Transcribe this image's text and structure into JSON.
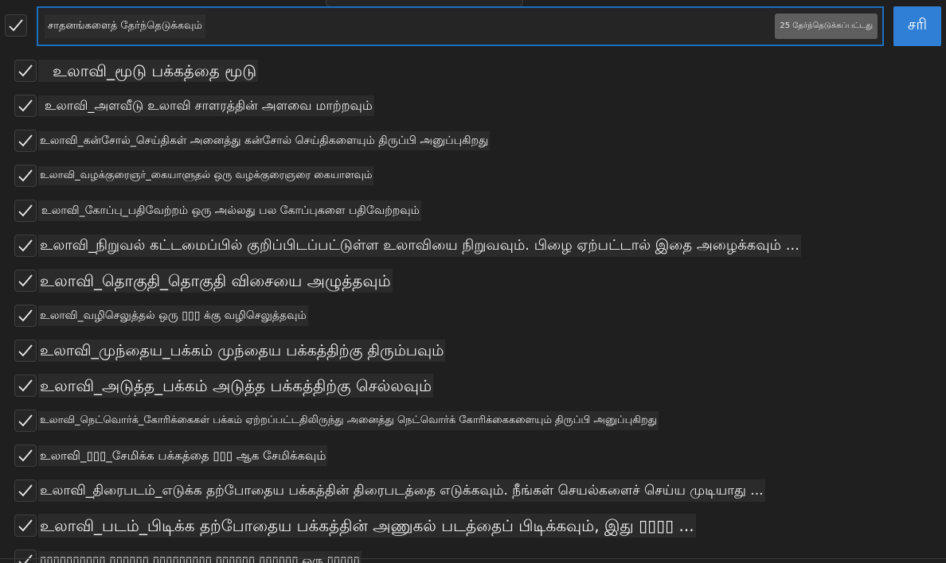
{
  "search": {
    "value": "சாதனங்களைத் தேர்ந்தெடுக்கவும்",
    "count_badge": "25 தேர்ந்தெடுக்கப்பட்டது",
    "ok_label": "சரி"
  },
  "tools": [
    {
      "name": "உலாவி_மூடு",
      "desc": "பக்கத்தை மூடு"
    },
    {
      "name": "உலாவி_அளவீடு",
      "desc": "உலாவி சாளரத்தின் அளவை மாற்றவும்"
    },
    {
      "name": "உலாவி_கன்சோல்_செய்திகள்",
      "desc": "அனைத்து கன்சோல் செய்திகளையும் திருப்பி அனுப்புகிறது"
    },
    {
      "name": "உலாவி_வழக்குரைஞர்_கையாளுதல்",
      "desc": "ஒரு வழக்குரைஞரை கையாளவும்"
    },
    {
      "name": "உலாவி_கோப்பு_பதிவேற்றம்",
      "desc": "ஒரு அல்லது பல கோப்புகளை பதிவேற்றவும்"
    },
    {
      "name": "உலாவி_நிறுவல்",
      "desc": "கட்டமைப்பில் குறிப்பிடப்பட்டுள்ள உலாவியை நிறுவவும். பிழை ஏற்பட்டால் இதை அழைக்கவும் ..."
    },
    {
      "name": "உலாவி_தொகுதி_தொகுதி",
      "desc": "விசையை அழுத்தவும்"
    },
    {
      "name": "உலாவி_வழிசெலுத்தல்",
      "desc": "ஒரு ▯▯▯ க்கு வழிசெலுத்தவும்"
    },
    {
      "name": "உலாவி_முந்தைய_பக்கம்",
      "desc": "முந்தைய பக்கத்திற்கு திரும்பவும்"
    },
    {
      "name": "உலாவி_அடுத்த_பக்கம்",
      "desc": "அடுத்த பக்கத்திற்கு செல்லவும்"
    },
    {
      "name": "உலாவி_நெட்வொர்க்_கோரிக்கைகள்",
      "desc": "பக்கம் ஏற்றப்பட்டதிலிருந்து அனைத்து நெட்வொர்க் கோரிக்கைகளையும் திருப்பி அனுப்புகிறது"
    },
    {
      "name": "உலாவி_▯▯▯_சேமிக்க",
      "desc": "பக்கத்தை ▯▯▯ ஆக சேமிக்கவும்"
    },
    {
      "name": "உலாவி_திரைபடம்_எடுக்க",
      "desc": "தற்போதைய பக்கத்தின் திரைபடத்தை எடுக்கவும். நீங்கள் செயல்களைச் செய்ய முடியாது ..."
    },
    {
      "name": "உலாவி_படம்_பிடிக்க",
      "desc": "தற்போதைய பக்கத்தின் அணுகல் படத்தைப் பிடிக்கவும், இது ▯▯▯▯ ..."
    },
    {
      "name": "▯▯▯▯▯▯▯▯▯▯ ▯▯▯▯▯▯ ▯▯▯▯▯▯▯▯▯ ▯▯▯▯▯▯",
      "desc": "▯▯▯▯▯▯ ஒரு ▯▯▯▯▯"
    }
  ]
}
